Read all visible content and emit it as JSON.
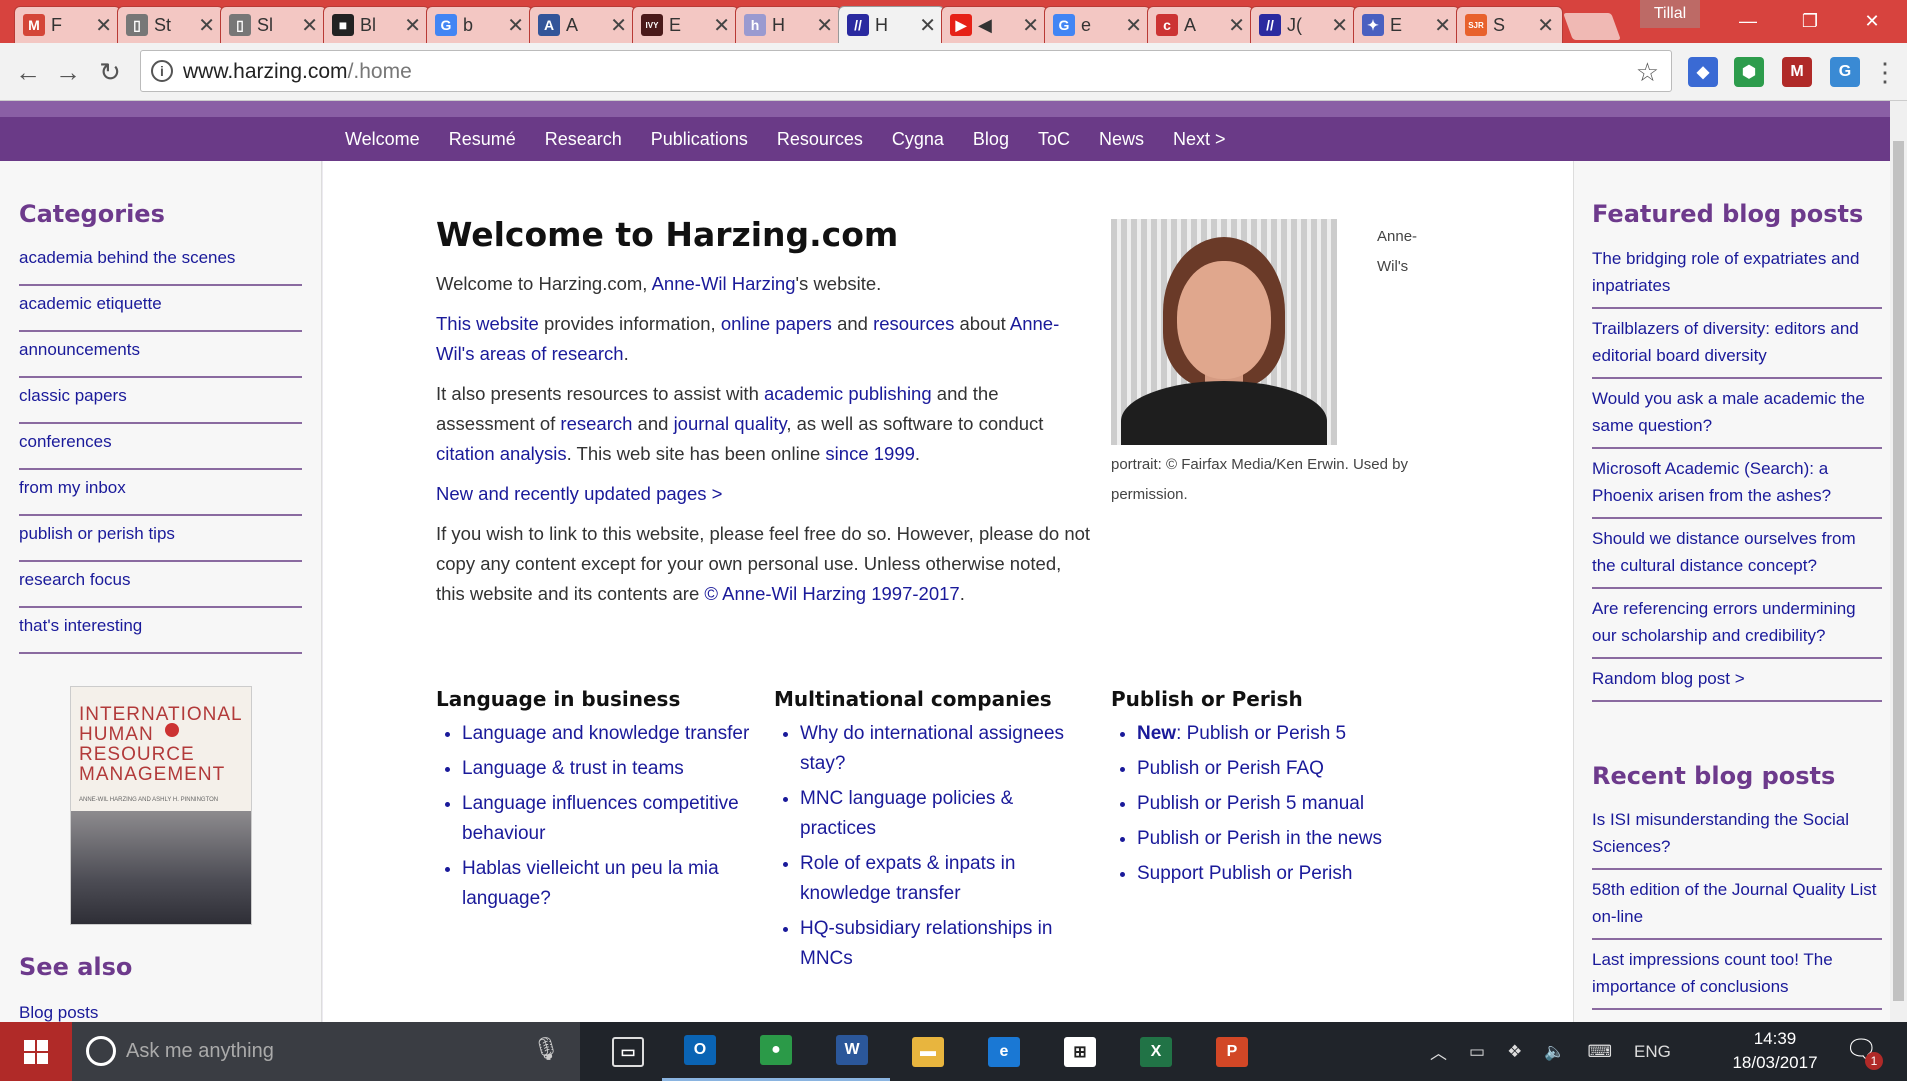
{
  "browser": {
    "tabs": [
      {
        "icon": "gmail-icon",
        "short": "F",
        "glyph": "M",
        "color": "#d44638"
      },
      {
        "icon": "document-icon",
        "short": "St",
        "glyph": "▯",
        "color": "#777"
      },
      {
        "icon": "document-icon",
        "short": "Sl",
        "glyph": "▯",
        "color": "#777"
      },
      {
        "icon": "bbc-icon",
        "short": "Bl",
        "glyph": "■",
        "color": "#222"
      },
      {
        "icon": "google-icon",
        "short": "b",
        "glyph": "G",
        "color": "#4285f4"
      },
      {
        "icon": "app-icon",
        "short": "A",
        "glyph": "A",
        "color": "#335599"
      },
      {
        "icon": "ivy-icon",
        "short": "E",
        "glyph": "IVY",
        "color": "#4a1a1a"
      },
      {
        "icon": "hefce-icon",
        "short": "H",
        "glyph": "h",
        "color": "#9a9ad0"
      },
      {
        "icon": "harzing-icon",
        "short": "H",
        "glyph": "//",
        "color": "#2a2aa0",
        "active": true
      },
      {
        "icon": "youtube-icon",
        "short": "◀",
        "glyph": "▶",
        "color": "#e62117"
      },
      {
        "icon": "google-icon",
        "short": "e",
        "glyph": "G",
        "color": "#4285f4"
      },
      {
        "icon": "cabs-icon",
        "short": "A",
        "glyph": "c",
        "color": "#cc3333"
      },
      {
        "icon": "harzing-icon",
        "short": "J(",
        "glyph": "//",
        "color": "#2a2aa0"
      },
      {
        "icon": "app-icon",
        "short": "E",
        "glyph": "✦",
        "color": "#4a60c0"
      },
      {
        "icon": "sjr-icon",
        "short": "S",
        "glyph": "SJR",
        "color": "#e8612c"
      }
    ],
    "profile_name": "Tillal",
    "url_host": "www.harzing.com",
    "url_path": "/.home"
  },
  "site": {
    "nav": [
      "Welcome",
      "Resumé",
      "Research",
      "Publications",
      "Resources",
      "Cygna",
      "Blog",
      "ToC",
      "News",
      "Next >"
    ],
    "left": {
      "categories_title": "Categories",
      "categories": [
        "academia behind the scenes",
        "academic etiquette",
        "announcements",
        "classic papers",
        "conferences",
        "from my inbox",
        "publish or perish tips",
        "research focus",
        "that's interesting"
      ],
      "book": {
        "title_lines": [
          "INTERNATIONAL",
          "HUMAN",
          "RESOURCE",
          "MANAGEMENT"
        ],
        "authors": "ANNE-WIL HARZING AND ASHLY H. PINNINGTON"
      },
      "see_also_title": "See also",
      "see_also": [
        "Blog posts"
      ]
    },
    "main": {
      "title": "Welcome to Harzing.com",
      "p1": {
        "a": "Welcome to Harzing.com, ",
        "link": "Anne-Wil Harzing",
        "b": "'s website."
      },
      "p2": {
        "l1": "This website",
        "t1": " provides information, ",
        "l2": "online papers",
        "t2": " and ",
        "l3": "resources",
        "t3": " about ",
        "l4": "Anne-Wil's areas of research",
        "t4": "."
      },
      "p3": {
        "t1": "It also presents resources to assist with ",
        "l1": "academic publishing",
        "t2": " and the assessment of ",
        "l2": "research",
        "t3": " and ",
        "l3": "journal quality",
        "t4": ", as well as software to conduct ",
        "l4": "citation analysis",
        "t5": ". This web site has been online ",
        "l5": "since 1999",
        "t6": "."
      },
      "p4": "New and recently updated pages >",
      "p5": {
        "t1": "If you wish to link to this website, please feel free do so. However, please do not copy any content except for your own personal use. Unless otherwise noted, this website and its contents are ",
        "l1": "© Anne-Wil Harzing 1997-2017",
        "t2": "."
      },
      "portrait_side": "Anne-\nWil's",
      "portrait_caption": "portrait: © Fairfax Media/Ken Erwin. Used by permission.",
      "columns": [
        {
          "title": "Language in business",
          "items": [
            "Language and knowledge transfer",
            "Language & trust in teams",
            "Language influences competitive behaviour",
            "Hablas vielleicht un peu la mia language?"
          ]
        },
        {
          "title": "Multinational companies",
          "items": [
            "Why do international assignees stay?",
            "MNC language policies & practices",
            "Role of expats & inpats in knowledge transfer",
            "HQ-subsidiary relationships in MNCs"
          ]
        },
        {
          "title": "Publish or Perish",
          "new_label": "New",
          "items": [
            ": Publish or Perish 5",
            "Publish or Perish FAQ",
            "Publish or Perish 5 manual",
            "Publish or Perish in the news",
            "Support Publish or Perish"
          ]
        }
      ]
    },
    "right": {
      "featured_title": "Featured blog posts",
      "featured": [
        "The bridging role of expatriates and inpatriates",
        "Trailblazers of diversity: editors and editorial board diversity",
        "Would you ask a male academic the same question?",
        "Microsoft Academic (Search): a Phoenix arisen from the ashes?",
        "Should we distance ourselves from the cultural distance concept?",
        "Are referencing errors undermining our scholarship and credibility?",
        "Random blog post >"
      ],
      "recent_title": "Recent blog posts",
      "recent": [
        "Is ISI misunderstanding the Social Sciences?",
        "58th edition of the Journal Quality List on-line",
        "Last impressions count too! The importance of conclusions"
      ]
    }
  },
  "taskbar": {
    "search_placeholder": "Ask me anything",
    "lang": "ENG",
    "time": "14:39",
    "date": "18/03/2017",
    "notification_count": "1",
    "apps": [
      {
        "name": "task-view",
        "glyph": "▭",
        "color": "#20242a"
      },
      {
        "name": "outlook",
        "glyph": "O",
        "color": "#0a64b4"
      },
      {
        "name": "chrome",
        "glyph": "●",
        "color": "#2b9a48"
      },
      {
        "name": "word",
        "glyph": "W",
        "color": "#2b579a"
      },
      {
        "name": "file-explorer",
        "glyph": "▬",
        "color": "#e8b53e"
      },
      {
        "name": "edge",
        "glyph": "e",
        "color": "#1a78d4"
      },
      {
        "name": "store",
        "glyph": "⊞",
        "color": "#ffffff"
      },
      {
        "name": "excel",
        "glyph": "X",
        "color": "#217346"
      },
      {
        "name": "powerpoint",
        "glyph": "P",
        "color": "#d24726"
      }
    ]
  }
}
